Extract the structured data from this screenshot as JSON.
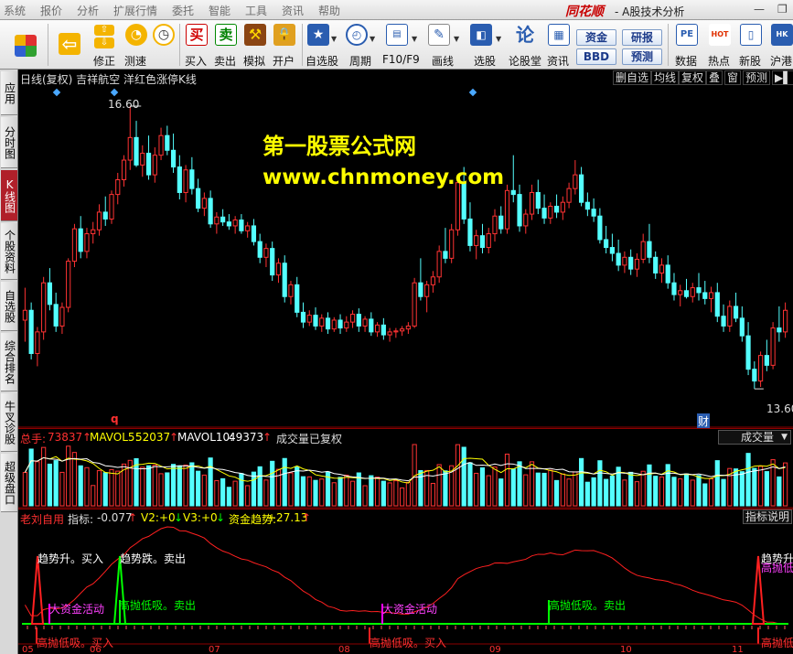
{
  "menu": {
    "items": [
      "系统",
      "报价",
      "分析",
      "扩展行情",
      "委托",
      "智能",
      "工具",
      "资讯",
      "帮助"
    ],
    "brand": "同花顺",
    "brand_sub": "- A股技术分析"
  },
  "toolbar": {
    "buttons": [
      {
        "label": "",
        "icon": "multi-window-icon"
      },
      {
        "label": "",
        "icon": "back-arrow-icon"
      },
      {
        "label": "修正",
        "icon": "up-down-icon"
      },
      {
        "label": "测速",
        "icon": "speed-icon"
      },
      {
        "label": "买入",
        "icon": "buy-icon",
        "glyph": "买"
      },
      {
        "label": "卖出",
        "icon": "sell-icon",
        "glyph": "卖"
      },
      {
        "label": "模拟",
        "icon": "hammer-icon"
      },
      {
        "label": "开户",
        "icon": "lock-icon"
      },
      {
        "label": "自选股",
        "icon": "star-icon"
      },
      {
        "label": "周期",
        "icon": "clock-icon"
      },
      {
        "label": "F10/F9",
        "icon": "f10-icon"
      },
      {
        "label": "画线",
        "icon": "pencil-icon"
      },
      {
        "label": "选股",
        "icon": "select-stock-icon"
      },
      {
        "label": "论股堂",
        "icon": "forum-icon",
        "glyph": "论"
      },
      {
        "label": "资讯",
        "icon": "news-icon"
      },
      {
        "label": "数据",
        "icon": "pe-icon",
        "glyph": "PE"
      },
      {
        "label": "热点",
        "icon": "hot-icon",
        "glyph": "HOT"
      },
      {
        "label": "新股",
        "icon": "ipo-icon"
      },
      {
        "label": "沪港",
        "icon": "hk-icon",
        "glyph": "HK"
      }
    ],
    "small_buttons": [
      "资金",
      "BBD",
      "研报",
      "预测"
    ]
  },
  "left_tabs": [
    {
      "label": "应用",
      "active": false
    },
    {
      "label": "分时图",
      "active": false
    },
    {
      "label": "K线图",
      "active": true
    },
    {
      "label": "个股资料",
      "active": false
    },
    {
      "label": "自选股",
      "active": false
    },
    {
      "label": "综合排名",
      "active": false
    },
    {
      "label": "牛叉诊股",
      "active": false
    },
    {
      "label": "超级盘口",
      "active": false
    }
  ],
  "chart_header": {
    "title": "日线(复权)  吉祥航空  洋红色涨停K线",
    "buttons": [
      "删自选",
      "均线",
      "复权",
      "叠",
      "窗",
      "预测",
      "▶▌"
    ]
  },
  "watermark": {
    "line1": "第一股票公式网",
    "line2": "www.chnmoney.com"
  },
  "price_markers": {
    "high": "16.60",
    "low": "13.60",
    "q_marker": "q",
    "cai_marker": "财"
  },
  "volume_panel": {
    "total_label": "总手:",
    "total_value": "73837",
    "mavol5_label": "MAVOL5:",
    "mavol5_value": "52037",
    "mavol10_label": "MAVOL10:",
    "mavol10_value": "49373",
    "note": "成交量已复权",
    "dropdown": "成交量"
  },
  "indicator_panel": {
    "name": "老刘自用",
    "label1": "指标:",
    "value1": "-0.077",
    "label2": "V2:",
    "value2": "+0",
    "label3": "V3:",
    "value3": "+0",
    "label4": "资金趋势:",
    "value4": "+27.13",
    "help": "指标说明",
    "annotations": [
      "趋势升。买入",
      "趋势跌。卖出",
      "大资金活动",
      "高抛低吸。卖出",
      "高抛低吸。买入",
      "大资金活动",
      "高抛低吸。卖出",
      "趋势升",
      "高抛低吸",
      "高抛低吸"
    ]
  },
  "x_axis_labels": [
    "05",
    "06",
    "07",
    "08",
    "09",
    "10",
    "11"
  ],
  "colors": {
    "up": "#ff3333",
    "down": "#54ffff",
    "ma_white": "#ffffff",
    "ma_yellow": "#ffff00",
    "indicator_red": "#ff2020",
    "indicator_green": "#00ff00",
    "indicator_magenta": "#ff00ff",
    "watermark": "#ffff00"
  },
  "chart_data": {
    "type": "candlestick",
    "price_high_label": 16.6,
    "price_low_label": 13.6,
    "ohlc": [
      [
        14.42,
        14.75,
        14.2,
        14.52
      ],
      [
        14.52,
        14.6,
        14.02,
        14.08
      ],
      [
        14.08,
        14.35,
        13.95,
        14.3
      ],
      [
        14.3,
        14.86,
        14.22,
        14.8
      ],
      [
        14.8,
        14.95,
        14.52,
        14.58
      ],
      [
        14.58,
        14.7,
        14.3,
        14.36
      ],
      [
        14.36,
        14.6,
        14.28,
        14.55
      ],
      [
        14.55,
        15.05,
        14.5,
        15.02
      ],
      [
        15.02,
        15.4,
        14.96,
        15.35
      ],
      [
        15.35,
        15.48,
        15.05,
        15.12
      ],
      [
        15.12,
        15.36,
        15.05,
        15.3
      ],
      [
        15.3,
        15.42,
        15.2,
        15.34
      ],
      [
        15.34,
        15.6,
        15.28,
        15.52
      ],
      [
        15.52,
        15.68,
        15.38,
        15.45
      ],
      [
        15.45,
        15.74,
        15.4,
        15.7
      ],
      [
        15.7,
        15.92,
        15.6,
        15.85
      ],
      [
        15.85,
        16.1,
        15.78,
        16.05
      ],
      [
        16.05,
        16.6,
        15.95,
        16.28
      ],
      [
        16.28,
        16.45,
        15.98,
        16.0
      ],
      [
        16.0,
        16.2,
        15.88,
        16.12
      ],
      [
        16.12,
        16.3,
        15.85,
        15.9
      ],
      [
        15.9,
        16.18,
        15.82,
        16.1
      ],
      [
        16.1,
        16.38,
        16.05,
        16.3
      ],
      [
        16.3,
        16.4,
        16.1,
        16.15
      ],
      [
        16.15,
        16.32,
        15.92,
        15.98
      ],
      [
        15.98,
        16.1,
        15.65,
        15.72
      ],
      [
        15.72,
        16.0,
        15.62,
        15.95
      ],
      [
        15.95,
        16.08,
        15.7,
        15.76
      ],
      [
        15.76,
        15.86,
        15.52,
        15.56
      ],
      [
        15.56,
        15.72,
        15.48,
        15.66
      ],
      [
        15.66,
        15.74,
        15.36,
        15.4
      ],
      [
        15.4,
        15.52,
        15.3,
        15.47
      ],
      [
        15.47,
        15.55,
        15.38,
        15.42
      ],
      [
        15.42,
        15.5,
        15.34,
        15.38
      ],
      [
        15.38,
        15.48,
        15.3,
        15.44
      ],
      [
        15.44,
        15.5,
        15.3,
        15.33
      ],
      [
        15.33,
        15.42,
        15.26,
        15.38
      ],
      [
        15.38,
        15.45,
        15.18,
        15.22
      ],
      [
        15.22,
        15.3,
        15.0,
        15.06
      ],
      [
        15.06,
        15.2,
        14.96,
        15.15
      ],
      [
        15.15,
        15.22,
        14.82,
        14.88
      ],
      [
        14.88,
        15.05,
        14.8,
        15.0
      ],
      [
        15.0,
        15.08,
        14.6,
        14.66
      ],
      [
        14.66,
        14.82,
        14.58,
        14.78
      ],
      [
        14.78,
        14.86,
        14.45,
        14.5
      ],
      [
        14.5,
        14.6,
        14.34,
        14.4
      ],
      [
        14.4,
        14.52,
        14.36,
        14.47
      ],
      [
        14.47,
        14.55,
        14.32,
        14.36
      ],
      [
        14.36,
        14.48,
        14.3,
        14.44
      ],
      [
        14.44,
        14.5,
        14.28,
        14.33
      ],
      [
        14.33,
        14.45,
        14.3,
        14.42
      ],
      [
        14.42,
        14.48,
        14.28,
        14.34
      ],
      [
        14.34,
        14.46,
        14.3,
        14.4
      ],
      [
        14.4,
        14.52,
        14.34,
        14.48
      ],
      [
        14.48,
        14.54,
        14.3,
        14.36
      ],
      [
        14.36,
        14.46,
        14.3,
        14.43
      ],
      [
        14.43,
        14.5,
        14.26,
        14.3
      ],
      [
        14.3,
        14.4,
        14.25,
        14.37
      ],
      [
        14.37,
        14.44,
        14.22,
        14.27
      ],
      [
        14.27,
        14.34,
        14.2,
        14.3
      ],
      [
        14.3,
        14.34,
        14.24,
        14.31
      ],
      [
        14.31,
        14.36,
        14.26,
        14.33
      ],
      [
        14.33,
        14.4,
        14.28,
        14.36
      ],
      [
        14.36,
        14.85,
        14.34,
        14.8
      ],
      [
        14.8,
        15.05,
        14.62,
        14.66
      ],
      [
        14.66,
        14.82,
        14.5,
        14.78
      ],
      [
        14.78,
        14.92,
        14.7,
        14.86
      ],
      [
        14.86,
        15.18,
        14.8,
        15.12
      ],
      [
        15.12,
        15.36,
        15.0,
        15.05
      ],
      [
        15.05,
        15.4,
        15.0,
        15.34
      ],
      [
        15.34,
        15.9,
        15.28,
        15.82
      ],
      [
        15.82,
        15.98,
        15.4,
        15.45
      ],
      [
        15.45,
        15.62,
        15.12,
        15.18
      ],
      [
        15.18,
        15.34,
        15.04,
        15.28
      ],
      [
        15.28,
        15.4,
        15.1,
        15.16
      ],
      [
        15.16,
        15.36,
        15.1,
        15.3
      ],
      [
        15.3,
        15.55,
        15.22,
        15.48
      ],
      [
        15.48,
        15.58,
        15.3,
        15.35
      ],
      [
        15.35,
        15.8,
        15.3,
        15.74
      ],
      [
        15.74,
        16.1,
        15.62,
        15.7
      ],
      [
        15.7,
        15.8,
        15.32,
        15.38
      ],
      [
        15.38,
        15.55,
        15.3,
        15.5
      ],
      [
        15.5,
        15.8,
        15.44,
        15.72
      ],
      [
        15.72,
        15.85,
        15.5,
        15.56
      ],
      [
        15.56,
        15.7,
        15.4,
        15.46
      ],
      [
        15.46,
        15.62,
        15.4,
        15.58
      ],
      [
        15.58,
        15.7,
        15.46,
        15.52
      ],
      [
        15.52,
        15.68,
        15.44,
        15.62
      ],
      [
        15.62,
        15.82,
        15.56,
        15.76
      ],
      [
        15.76,
        16.05,
        15.7,
        15.9
      ],
      [
        15.9,
        15.98,
        15.58,
        15.62
      ],
      [
        15.62,
        15.72,
        15.48,
        15.55
      ],
      [
        15.55,
        15.66,
        15.42,
        15.48
      ],
      [
        15.48,
        15.56,
        15.2,
        15.24
      ],
      [
        15.24,
        15.38,
        15.1,
        15.16
      ],
      [
        15.16,
        15.3,
        15.02,
        15.1
      ],
      [
        15.1,
        15.24,
        14.92,
        14.98
      ],
      [
        14.98,
        15.12,
        14.9,
        15.06
      ],
      [
        15.06,
        15.14,
        14.88,
        14.94
      ],
      [
        14.94,
        15.1,
        14.86,
        15.04
      ],
      [
        15.04,
        15.3,
        15.0,
        15.22
      ],
      [
        15.22,
        15.4,
        15.0,
        15.06
      ],
      [
        15.06,
        15.12,
        14.84,
        14.9
      ],
      [
        14.9,
        15.05,
        14.8,
        14.98
      ],
      [
        14.98,
        15.08,
        14.74,
        14.8
      ],
      [
        14.8,
        14.9,
        14.62,
        14.68
      ],
      [
        14.68,
        14.78,
        14.56,
        14.72
      ],
      [
        14.72,
        14.84,
        14.64,
        14.66
      ],
      [
        14.66,
        14.8,
        14.6,
        14.75
      ],
      [
        14.75,
        14.9,
        14.62,
        14.7
      ],
      [
        14.7,
        14.82,
        14.58,
        14.64
      ],
      [
        14.64,
        14.76,
        14.5,
        14.7
      ],
      [
        14.7,
        14.8,
        14.4,
        14.46
      ],
      [
        14.46,
        14.58,
        14.3,
        14.36
      ],
      [
        14.36,
        14.62,
        14.3,
        14.56
      ],
      [
        14.56,
        14.7,
        14.4,
        14.44
      ],
      [
        14.44,
        14.56,
        14.2,
        14.26
      ],
      [
        14.26,
        14.4,
        13.86,
        13.92
      ],
      [
        13.92,
        14.0,
        13.72,
        13.8
      ],
      [
        13.8,
        14.1,
        13.74,
        14.06
      ],
      [
        14.06,
        14.22,
        13.9,
        13.96
      ],
      [
        13.96,
        14.4,
        13.92,
        14.34
      ],
      [
        14.34,
        14.56,
        14.2,
        14.3
      ],
      [
        14.3,
        14.6,
        14.24,
        14.52
      ]
    ],
    "volume": {
      "unit": "手",
      "last": 73837,
      "mavol5": 52037,
      "mavol10": 49373
    },
    "indicator": {
      "value": -0.077,
      "v2": 0,
      "v3": 0,
      "fund_trend": 27.13
    }
  }
}
